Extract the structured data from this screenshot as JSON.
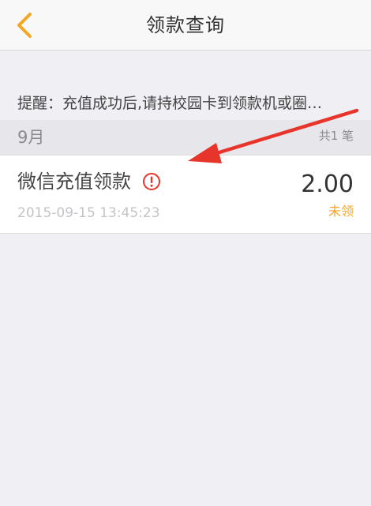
{
  "navbar": {
    "title": "领款查询",
    "back_icon": "chevron-left-icon",
    "accent_color": "#f5a623"
  },
  "notice": {
    "text": "提醒：充值成功后,请持校园卡到领款机或圈…"
  },
  "month_group": {
    "month": "9月",
    "count": "共1 笔"
  },
  "record": {
    "title": "微信充值领款",
    "warning_icon": "exclamation-circle-icon",
    "timestamp": "2015-09-15 13:45:23",
    "amount": "2.00",
    "status": "未领",
    "status_color": "#f5a623"
  },
  "annotation": {
    "arrow_color": "#e8352b"
  }
}
